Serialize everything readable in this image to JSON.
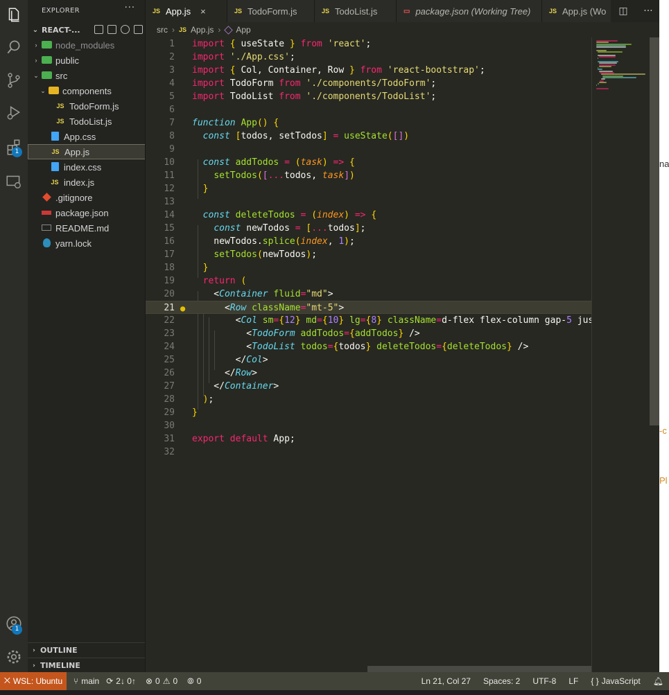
{
  "sidebar": {
    "title": "EXPLORER",
    "more": "···",
    "project": "REACT-...",
    "tree": [
      {
        "label": "node_modules",
        "chev": "›",
        "icon": "folder-green",
        "dim": true
      },
      {
        "label": "public",
        "chev": "›",
        "icon": "folder-green"
      },
      {
        "label": "src",
        "chev": "⌄",
        "icon": "folder-green"
      },
      {
        "label": "components",
        "chev": "⌄",
        "icon": "folder-yellow"
      },
      {
        "label": "TodoForm.js",
        "icon": "js"
      },
      {
        "label": "TodoList.js",
        "icon": "js"
      },
      {
        "label": "App.css",
        "icon": "css"
      },
      {
        "label": "App.js",
        "icon": "js",
        "selected": true
      },
      {
        "label": "index.css",
        "icon": "css"
      },
      {
        "label": "index.js",
        "icon": "js"
      },
      {
        "label": ".gitignore",
        "icon": "git"
      },
      {
        "label": "package.json",
        "icon": "npm"
      },
      {
        "label": "README.md",
        "icon": "md"
      },
      {
        "label": "yarn.lock",
        "icon": "yarn"
      }
    ],
    "outline": "OUTLINE",
    "timeline": "TIMELINE"
  },
  "activity": {
    "extensions_badge": "1",
    "accounts_badge": "1"
  },
  "tabs": [
    {
      "label": "App.js",
      "icon": "JS",
      "active": true,
      "close": "×"
    },
    {
      "label": "TodoForm.js",
      "icon": "JS"
    },
    {
      "label": "TodoList.js",
      "icon": "JS"
    },
    {
      "label": "package.json (Working Tree)",
      "icon": "json",
      "italic": true
    },
    {
      "label": "App.js (Wo",
      "icon": "JS"
    }
  ],
  "breadcrumb": {
    "folder": "src",
    "file": "App.js",
    "symbol": "App",
    "file_icon": "JS"
  },
  "editor": {
    "lines": [
      "import { useState } from 'react';",
      "import './App.css';",
      "import { Col, Container, Row } from 'react-bootstrap';",
      "import TodoForm from './components/TodoForm';",
      "import TodoList from './components/TodoList';",
      "",
      "function App() {",
      "  const [todos, setTodos] = useState([])",
      "",
      "  const addTodos = (task) => {",
      "    setTodos([...todos, task])",
      "  }",
      "",
      "  const deleteTodos = (index) => {",
      "    const newTodos = [...todos];",
      "    newTodos.splice(index, 1);",
      "    setTodos(newTodos);",
      "  }",
      "  return (",
      "    <Container fluid=\"md\">",
      "      <Row className=\"mt-5\">",
      "        <Col sm={12} md={10} lg={8} className='d-flex flex-column gap-5 jus",
      "          <TodoForm addTodos={addTodos} />",
      "          <TodoList todos={todos} deleteTodos={deleteTodos} />",
      "        </Col>",
      "      </Row>",
      "    </Container>",
      "  );",
      "}",
      "",
      "export default App;",
      ""
    ],
    "current_line": 21
  },
  "right_strip": [
    "na",
    "-c",
    "Pl"
  ],
  "status": {
    "remote": "WSL: Ubuntu",
    "branch": "main",
    "sync": "2↓ 0↑",
    "errors": "0",
    "warnings": "0",
    "ports": "0",
    "cursor": "Ln 21, Col 27",
    "spaces": "Spaces: 2",
    "encoding": "UTF-8",
    "eol": "LF",
    "language": "JavaScript",
    "language_icon": "{ }"
  }
}
